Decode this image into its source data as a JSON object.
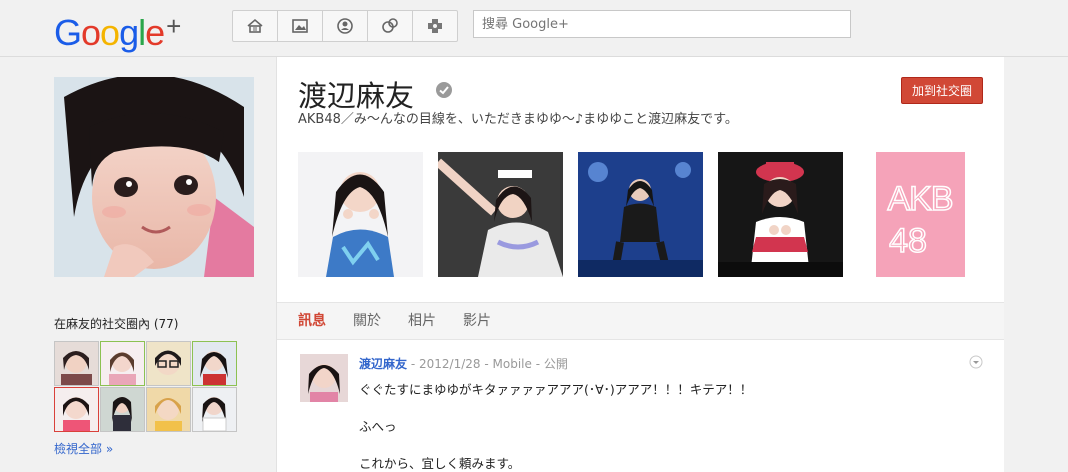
{
  "header": {
    "logo_text": "Google+",
    "nav_icons": [
      "home-icon",
      "photos-icon",
      "profile-icon",
      "circles-icon",
      "games-icon"
    ],
    "search": {
      "placeholder": "搜尋 Google+",
      "value": ""
    }
  },
  "profile": {
    "name": "渡辺麻友",
    "tagline": "AKB48／み～んなの目線を、いただきまゆゆ～♪まゆゆこと渡辺麻友です。",
    "add_button": "加到社交圈",
    "photos_alt": [
      "photo-1",
      "photo-2",
      "photo-3",
      "photo-4",
      "photo-5"
    ],
    "akb_logo_text": "AKB48"
  },
  "tabs": [
    {
      "label": "訊息",
      "active": true
    },
    {
      "label": "關於",
      "active": false
    },
    {
      "label": "相片",
      "active": false
    },
    {
      "label": "影片",
      "active": false
    }
  ],
  "sidebar": {
    "circles_title": "在麻友的社交圈內 (77)",
    "view_all": "檢視全部 »"
  },
  "post": {
    "author": "渡辺麻友",
    "date": "2012/1/28",
    "source": "Mobile",
    "visibility": "公開",
    "lines": [
      "ぐぐたすにまゆゆがキタァァァァアアア(･∀･)アアア！！！キテア！！",
      "ふへっ",
      "これから、宜しく頼みます。"
    ]
  },
  "colors": {
    "accent_red": "#d14836",
    "link_blue": "#3366cc",
    "akb_pink": "#f5a3b9"
  }
}
